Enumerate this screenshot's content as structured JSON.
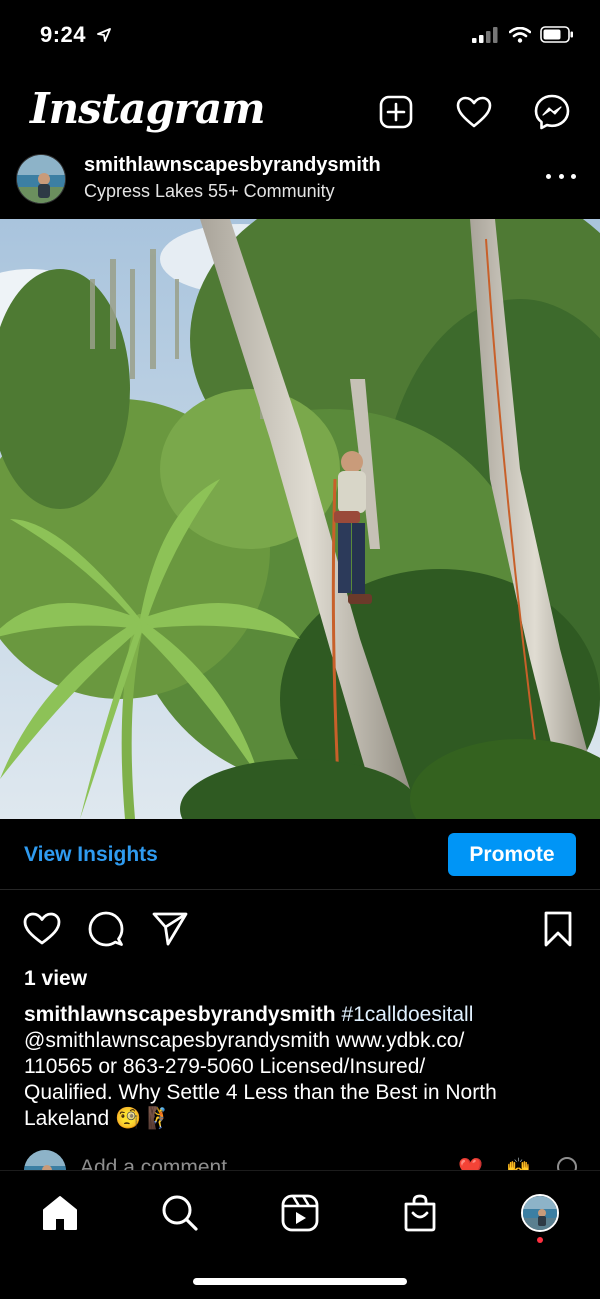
{
  "status_bar": {
    "time": "9:24",
    "icons": [
      "location-arrow-icon",
      "signal-icon",
      "wifi-icon",
      "battery-icon"
    ]
  },
  "header": {
    "logo": "Instagram",
    "actions": [
      "new-post-icon",
      "heart-icon",
      "messenger-icon"
    ]
  },
  "post": {
    "username": "smithlawnscapesbyrandysmith",
    "location": "Cypress Lakes 55+ Community",
    "image_alt": "tree-climber-photo",
    "insights_label": "View Insights",
    "promote_label": "Promote",
    "views": "1 view",
    "caption": {
      "username": "smithlawnscapesbyrandysmith",
      "hashtag": "#1calldoesitall",
      "line2": "@smithlawnscapesbyrandysmith www.ydbk.co/",
      "line3": "110565 or 863-279-5060 Licensed/Insured/",
      "line4": "Qualified. Why Settle 4 Less than the Best in North",
      "line5": "Lakeland",
      "emojis": "🧐 🧗"
    },
    "comment_placeholder": "Add a comment",
    "quick_reactions": [
      "❤️",
      "🙌"
    ]
  },
  "tab_bar": {
    "tabs": [
      "home-icon",
      "search-icon",
      "reels-icon",
      "shop-icon",
      "profile-avatar"
    ]
  },
  "colors": {
    "background": "#000000",
    "accent": "#0095f6",
    "link": "#2f9bf0",
    "notification": "#ff3040"
  }
}
